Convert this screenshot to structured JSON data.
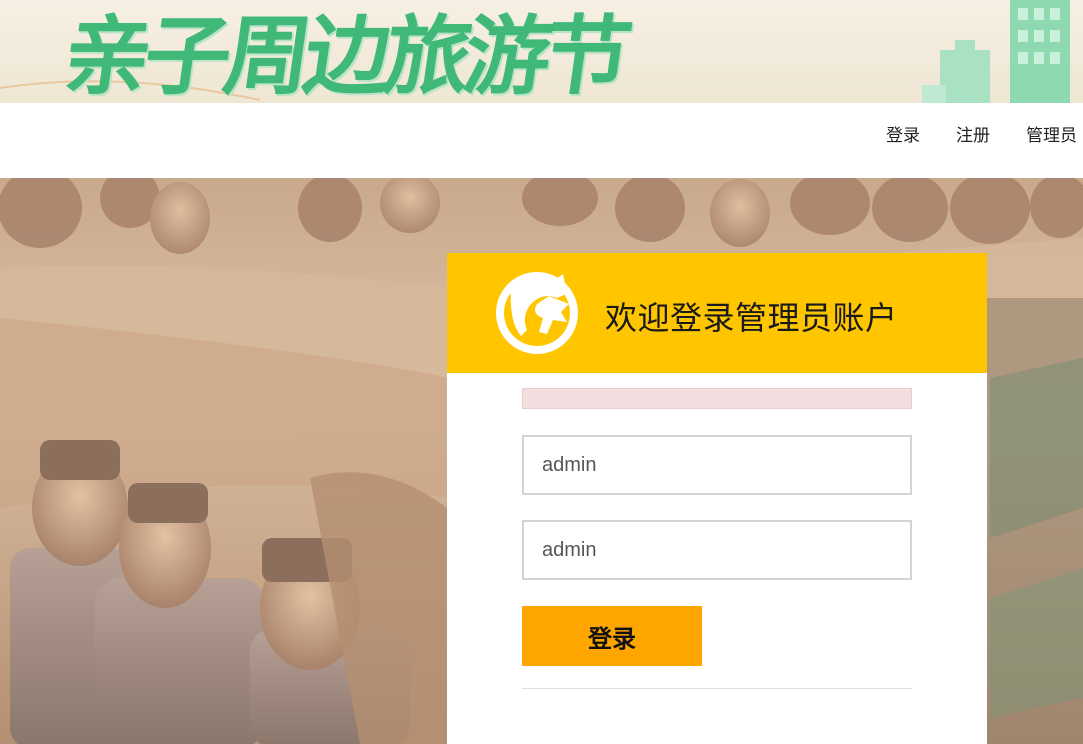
{
  "banner": {
    "title": "亲子周边旅游节"
  },
  "nav": {
    "items": [
      {
        "label": "登录",
        "name": "nav-link-login"
      },
      {
        "label": "注册",
        "name": "nav-link-register"
      },
      {
        "label": "管理员",
        "name": "nav-link-admin"
      }
    ]
  },
  "login": {
    "title": "欢迎登录管理员账户",
    "error_message": "",
    "username_value": "admin",
    "password_value": "admin",
    "submit_label": "登录"
  },
  "colors": {
    "header_bg": "#ffc600",
    "button_bg": "#ffa500",
    "banner_text": "#3fb878",
    "error_bg": "#f2dede"
  },
  "icons": {
    "logo": "horse-head-logo"
  }
}
